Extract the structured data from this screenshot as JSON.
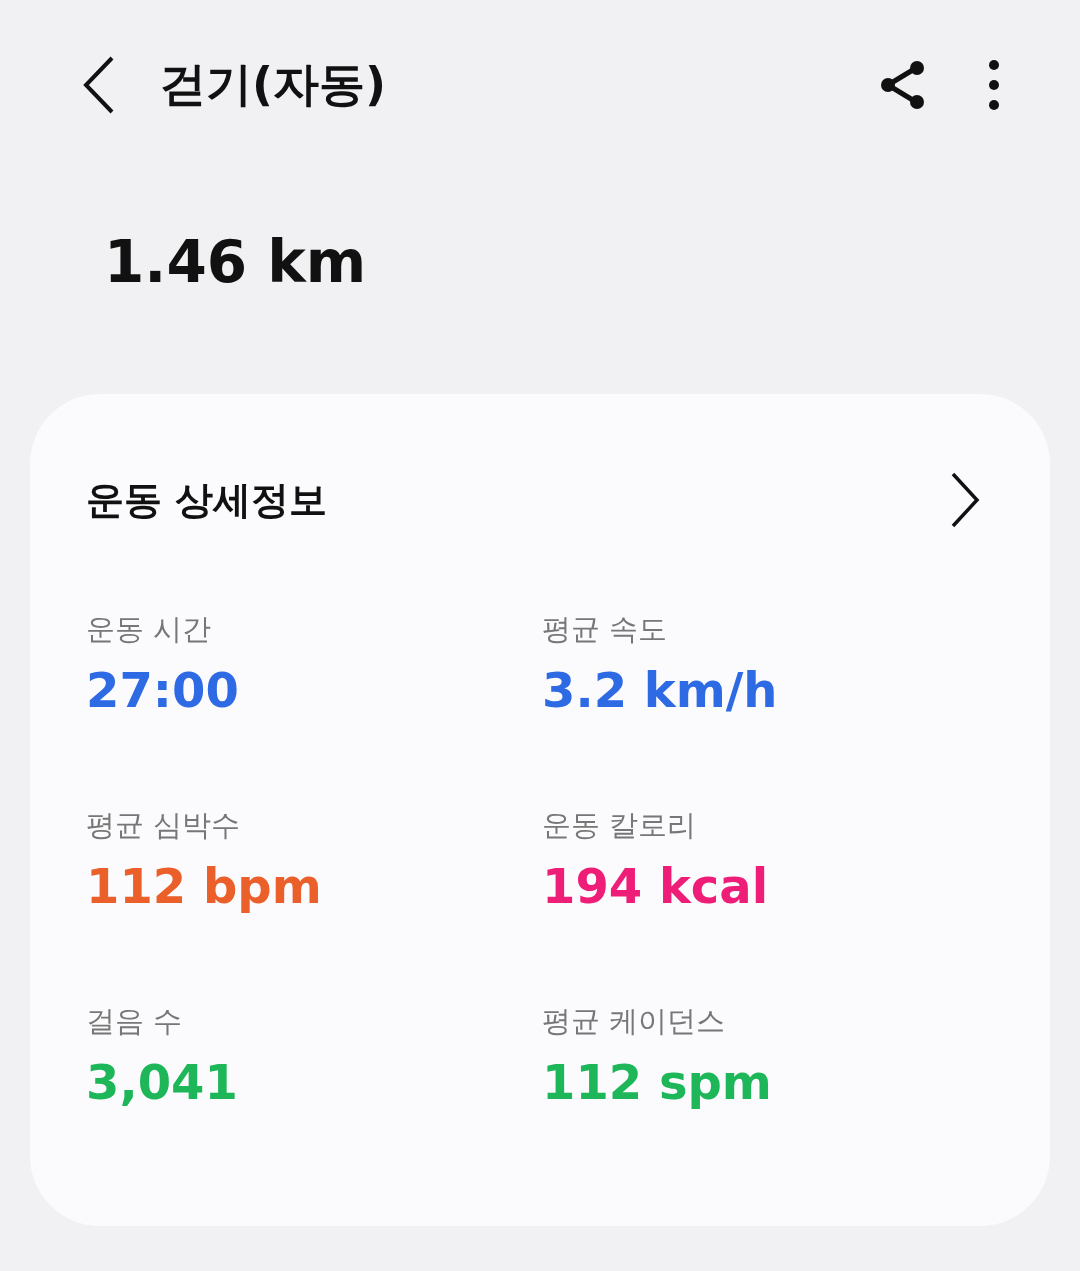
{
  "header": {
    "title": "걷기(자동)"
  },
  "distance": "1.46 km",
  "details": {
    "title": "운동 상세정보",
    "stats": [
      {
        "label": "운동 시간",
        "value": "27:00",
        "color": "#2e6ae3"
      },
      {
        "label": "평균 속도",
        "value": "3.2 km/h",
        "color": "#2e6ae3"
      },
      {
        "label": "평균 심박수",
        "value": "112 bpm",
        "color": "#eb5f2a"
      },
      {
        "label": "운동 칼로리",
        "value": "194 kcal",
        "color": "#ee1e78"
      },
      {
        "label": "걸음 수",
        "value": "3,041",
        "color": "#1db659"
      },
      {
        "label": "평균 케이던스",
        "value": "112 spm",
        "color": "#1db659"
      }
    ]
  }
}
